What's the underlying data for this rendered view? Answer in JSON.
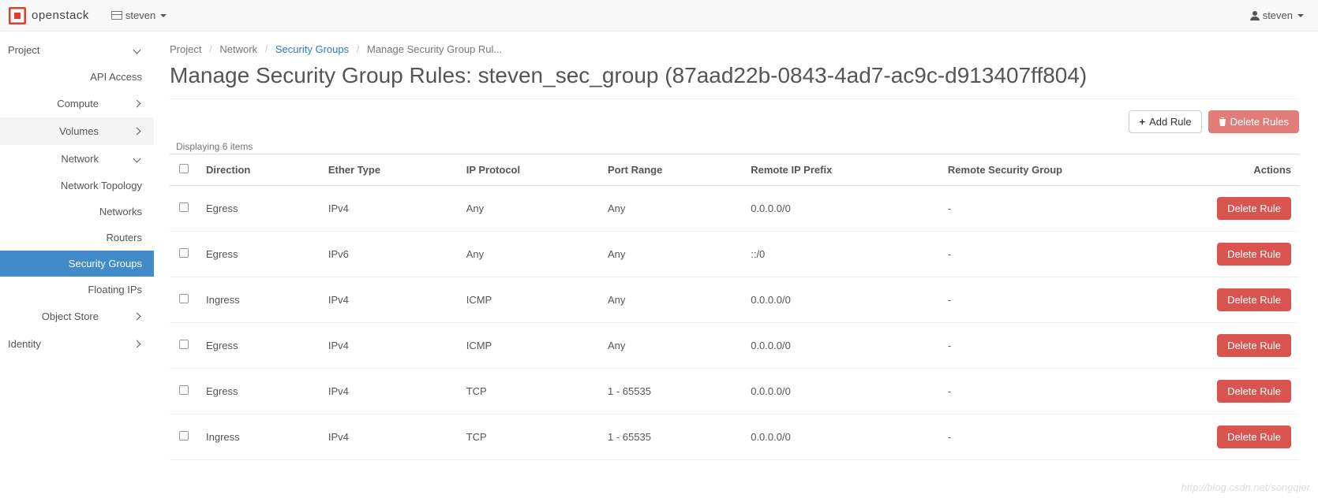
{
  "topbar": {
    "brand": "openstack",
    "tenant": "steven",
    "user": "steven"
  },
  "sidebar": {
    "project": "Project",
    "api_access": "API Access",
    "compute": "Compute",
    "volumes": "Volumes",
    "network": "Network",
    "network_items": {
      "topology": "Network Topology",
      "networks": "Networks",
      "routers": "Routers",
      "security_groups": "Security Groups",
      "floating_ips": "Floating IPs"
    },
    "object_store": "Object Store",
    "identity": "Identity"
  },
  "breadcrumbs": {
    "project": "Project",
    "network": "Network",
    "security_groups": "Security Groups",
    "current": "Manage Security Group Rul..."
  },
  "page_title": "Manage Security Group Rules: steven_sec_group (87aad22b-0843-4ad7-ac9c-d913407ff804)",
  "toolbar": {
    "add_rule": "Add Rule",
    "delete_rules": "Delete Rules"
  },
  "table": {
    "count_label": "Displaying 6 items",
    "headers": {
      "direction": "Direction",
      "ether": "Ether Type",
      "proto": "IP Protocol",
      "port": "Port Range",
      "remote_ip": "Remote IP Prefix",
      "remote_sg": "Remote Security Group",
      "actions": "Actions"
    },
    "rows": [
      {
        "direction": "Egress",
        "ether": "IPv4",
        "proto": "Any",
        "port": "Any",
        "remote_ip": "0.0.0.0/0",
        "remote_sg": "-",
        "action": "Delete Rule"
      },
      {
        "direction": "Egress",
        "ether": "IPv6",
        "proto": "Any",
        "port": "Any",
        "remote_ip": "::/0",
        "remote_sg": "-",
        "action": "Delete Rule"
      },
      {
        "direction": "Ingress",
        "ether": "IPv4",
        "proto": "ICMP",
        "port": "Any",
        "remote_ip": "0.0.0.0/0",
        "remote_sg": "-",
        "action": "Delete Rule"
      },
      {
        "direction": "Egress",
        "ether": "IPv4",
        "proto": "ICMP",
        "port": "Any",
        "remote_ip": "0.0.0.0/0",
        "remote_sg": "-",
        "action": "Delete Rule"
      },
      {
        "direction": "Egress",
        "ether": "IPv4",
        "proto": "TCP",
        "port": "1 - 65535",
        "remote_ip": "0.0.0.0/0",
        "remote_sg": "-",
        "action": "Delete Rule"
      },
      {
        "direction": "Ingress",
        "ether": "IPv4",
        "proto": "TCP",
        "port": "1 - 65535",
        "remote_ip": "0.0.0.0/0",
        "remote_sg": "-",
        "action": "Delete Rule"
      }
    ]
  },
  "watermark": "http://blog.csdn.net/songqier"
}
